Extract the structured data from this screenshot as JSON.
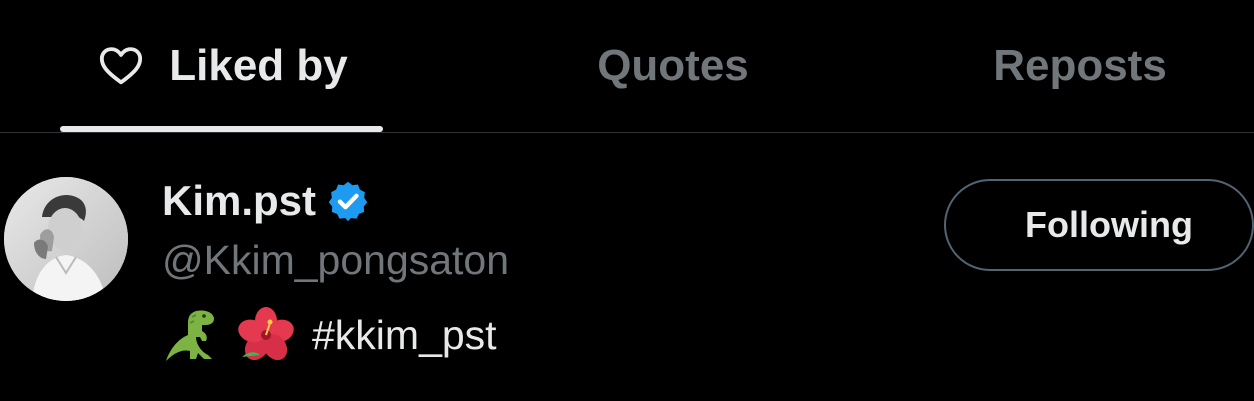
{
  "tabs": {
    "liked_by": {
      "label": "Liked by",
      "icon": "heart-outline-icon",
      "active": true
    },
    "quotes": {
      "label": "Quotes"
    },
    "reposts": {
      "label": "Reposts"
    }
  },
  "user": {
    "display_name": "Kim.pst",
    "verified": true,
    "handle": "@Kkim_pongsaton",
    "bio": {
      "emojis": [
        "🦖",
        "🌺"
      ],
      "text": "#kkim_pst"
    },
    "follow_button_label": "Following"
  },
  "colors": {
    "background": "#000000",
    "primary_text": "#e7e9ea",
    "secondary_text": "#71767b",
    "verified_blue": "#1d9bf0",
    "divider": "#2f3336"
  }
}
